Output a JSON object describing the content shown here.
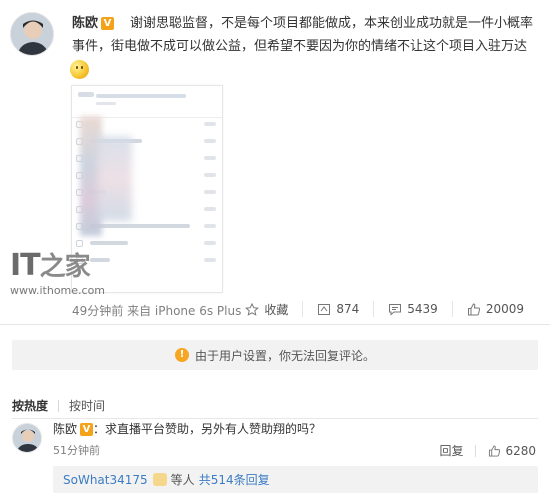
{
  "post": {
    "author": "陈欧",
    "verified_badge": "V",
    "text": "谢谢思聪监督，不是每个项目都能做成，本来创业成功就是一件小概率事件，街电做不成可以做公益，但希望不要因为你的情绪不让这个项目入驻万达",
    "emoji_icon": "smile-emoji-icon",
    "meta": "49分钟前 来自 iPhone 6s Plus",
    "actions": {
      "favorite": "收藏",
      "repost": "874",
      "comment": "5439",
      "like": "20009"
    }
  },
  "watermark": {
    "logo_latin": "IT",
    "logo_cn": "之家",
    "url": "www.ithome.com"
  },
  "notice": {
    "text": "由于用户设置，你无法回复评论。"
  },
  "tabs": {
    "hot": "按热度",
    "time": "按时间"
  },
  "comment": {
    "author": "陈欧",
    "badge": "V",
    "colon": "：",
    "text": "求直播平台赞助，另外有人赞助翔的吗？",
    "time": "51分钟前",
    "reply_label": "回复",
    "likes": "6280"
  },
  "subreply": {
    "user": "SoWhat34175",
    "mid": "等人",
    "count": "共514条回复"
  },
  "colors": {
    "link_blue": "#3b7cc4",
    "badge_orange": "#f5a21b",
    "notice_bg": "#f2f2f2"
  }
}
